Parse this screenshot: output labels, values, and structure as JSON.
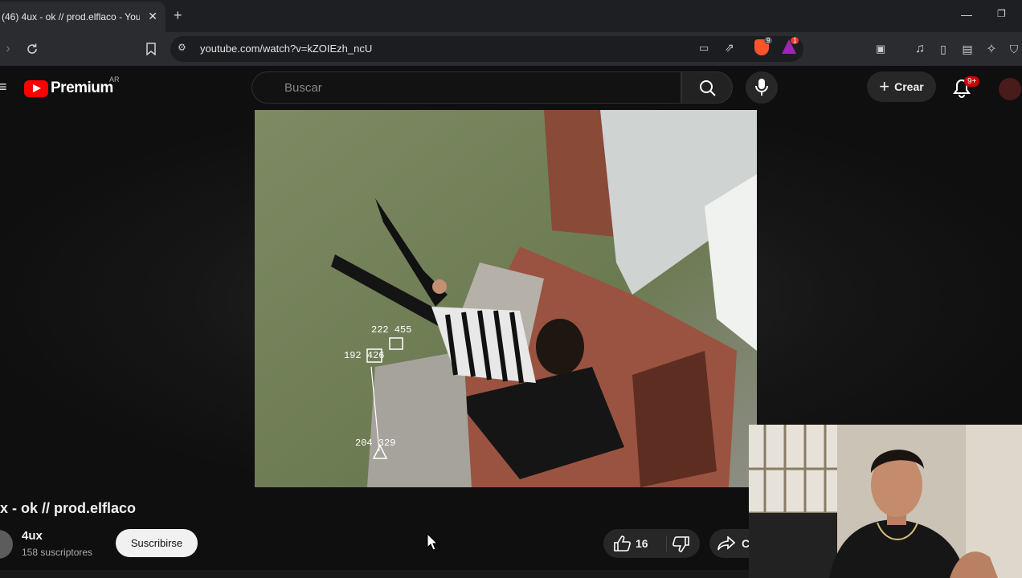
{
  "browser": {
    "tab_title": "(46) 4ux - ok // prod.elflaco - You",
    "url": "youtube.com/watch?v=kZOIEzh_ncU",
    "brave_badge": "9",
    "rewards_badge": "1"
  },
  "header": {
    "logo_text": "Premium",
    "region": "AR",
    "search_placeholder": "Buscar",
    "create_label": "Crear",
    "notifications_badge": "9+"
  },
  "video": {
    "overlay_labels": [
      "222 455",
      "192 426",
      "204 329"
    ]
  },
  "info": {
    "title": "x - ok // prod.elflaco",
    "channel": "4ux",
    "subscribers": "158 suscriptores",
    "subscribe_label": "Suscribirse",
    "likes": "16",
    "share_label": "C"
  },
  "colors": {
    "brand_red": "#ff0000",
    "background": "#0f0f0f"
  }
}
